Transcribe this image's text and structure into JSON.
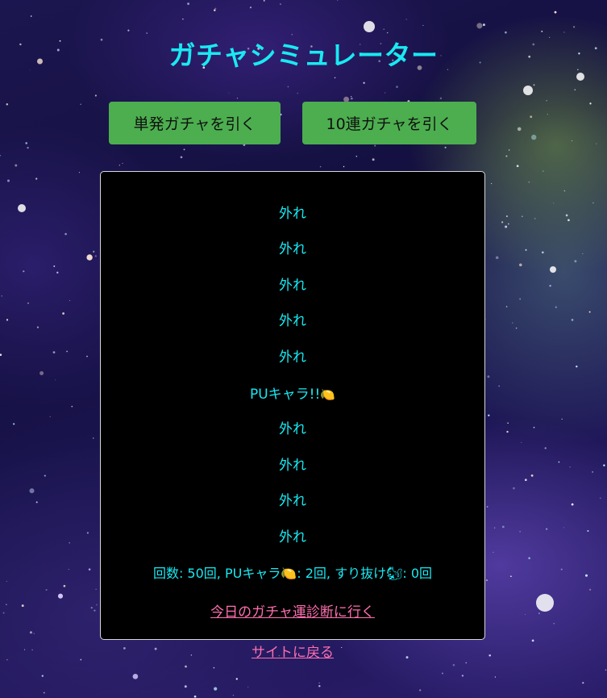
{
  "title": "ガチャシミュレーター",
  "buttons": {
    "single": "単発ガチャを引く",
    "ten": "10連ガチャを引く"
  },
  "results": [
    {
      "text": "外れ",
      "emoji": ""
    },
    {
      "text": "外れ",
      "emoji": ""
    },
    {
      "text": "外れ",
      "emoji": ""
    },
    {
      "text": "外れ",
      "emoji": ""
    },
    {
      "text": "外れ",
      "emoji": ""
    },
    {
      "text": "PUキャラ!!",
      "emoji": "🍋"
    },
    {
      "text": "外れ",
      "emoji": ""
    },
    {
      "text": "外れ",
      "emoji": ""
    },
    {
      "text": "外れ",
      "emoji": ""
    },
    {
      "text": "外れ",
      "emoji": ""
    }
  ],
  "summary": {
    "text": "回数: 50回, PUキャラ🍋: 2回, すり抜け🐿: 0回"
  },
  "links": {
    "diagnosis": "今日のガチャ運診断に行く",
    "back": "サイトに戻る"
  },
  "colors": {
    "title": "#19e9f2",
    "button": "#4cae4f",
    "link": "#ff6fb0",
    "panel": "#000000"
  }
}
